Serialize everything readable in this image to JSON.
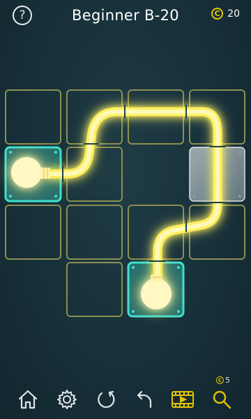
{
  "header": {
    "help_label": "?",
    "title": "Beginner B-20",
    "coin_symbol": "C",
    "coin_count": "20"
  },
  "board": {
    "rows": 4,
    "cols": 4,
    "cells": [
      {
        "row": 0,
        "col": 0,
        "type": "empty"
      },
      {
        "row": 0,
        "col": 1,
        "type": "empty"
      },
      {
        "row": 0,
        "col": 2,
        "type": "empty"
      },
      {
        "row": 0,
        "col": 3,
        "type": "empty"
      },
      {
        "row": 1,
        "col": 0,
        "type": "bulb-source",
        "fixed": true
      },
      {
        "row": 1,
        "col": 1,
        "type": "empty"
      },
      {
        "row": 1,
        "col": 3,
        "type": "locked-pipe",
        "fixed": true
      },
      {
        "row": 2,
        "col": 0,
        "type": "empty"
      },
      {
        "row": 2,
        "col": 1,
        "type": "empty"
      },
      {
        "row": 2,
        "col": 2,
        "type": "empty"
      },
      {
        "row": 2,
        "col": 3,
        "type": "empty"
      },
      {
        "row": 3,
        "col": 1,
        "type": "empty"
      },
      {
        "row": 3,
        "col": 2,
        "type": "bulb-target",
        "fixed": true
      }
    ],
    "colors": {
      "tile_border": "#8c8f4e",
      "fixed_tile": "#27c9b8",
      "glow": "#fff06a",
      "bulb": "#fff8c2",
      "locked_tile": "#b9c6cb"
    }
  },
  "toolbar": {
    "items": [
      {
        "name": "home",
        "icon": "home-icon"
      },
      {
        "name": "settings",
        "icon": "gear-icon"
      },
      {
        "name": "restart",
        "icon": "restart-icon"
      },
      {
        "name": "undo",
        "icon": "undo-icon"
      },
      {
        "name": "video",
        "icon": "film-play-icon"
      },
      {
        "name": "hint",
        "icon": "magnifier-icon"
      }
    ],
    "hint_coin_symbol": "C",
    "hint_cost": "5"
  }
}
